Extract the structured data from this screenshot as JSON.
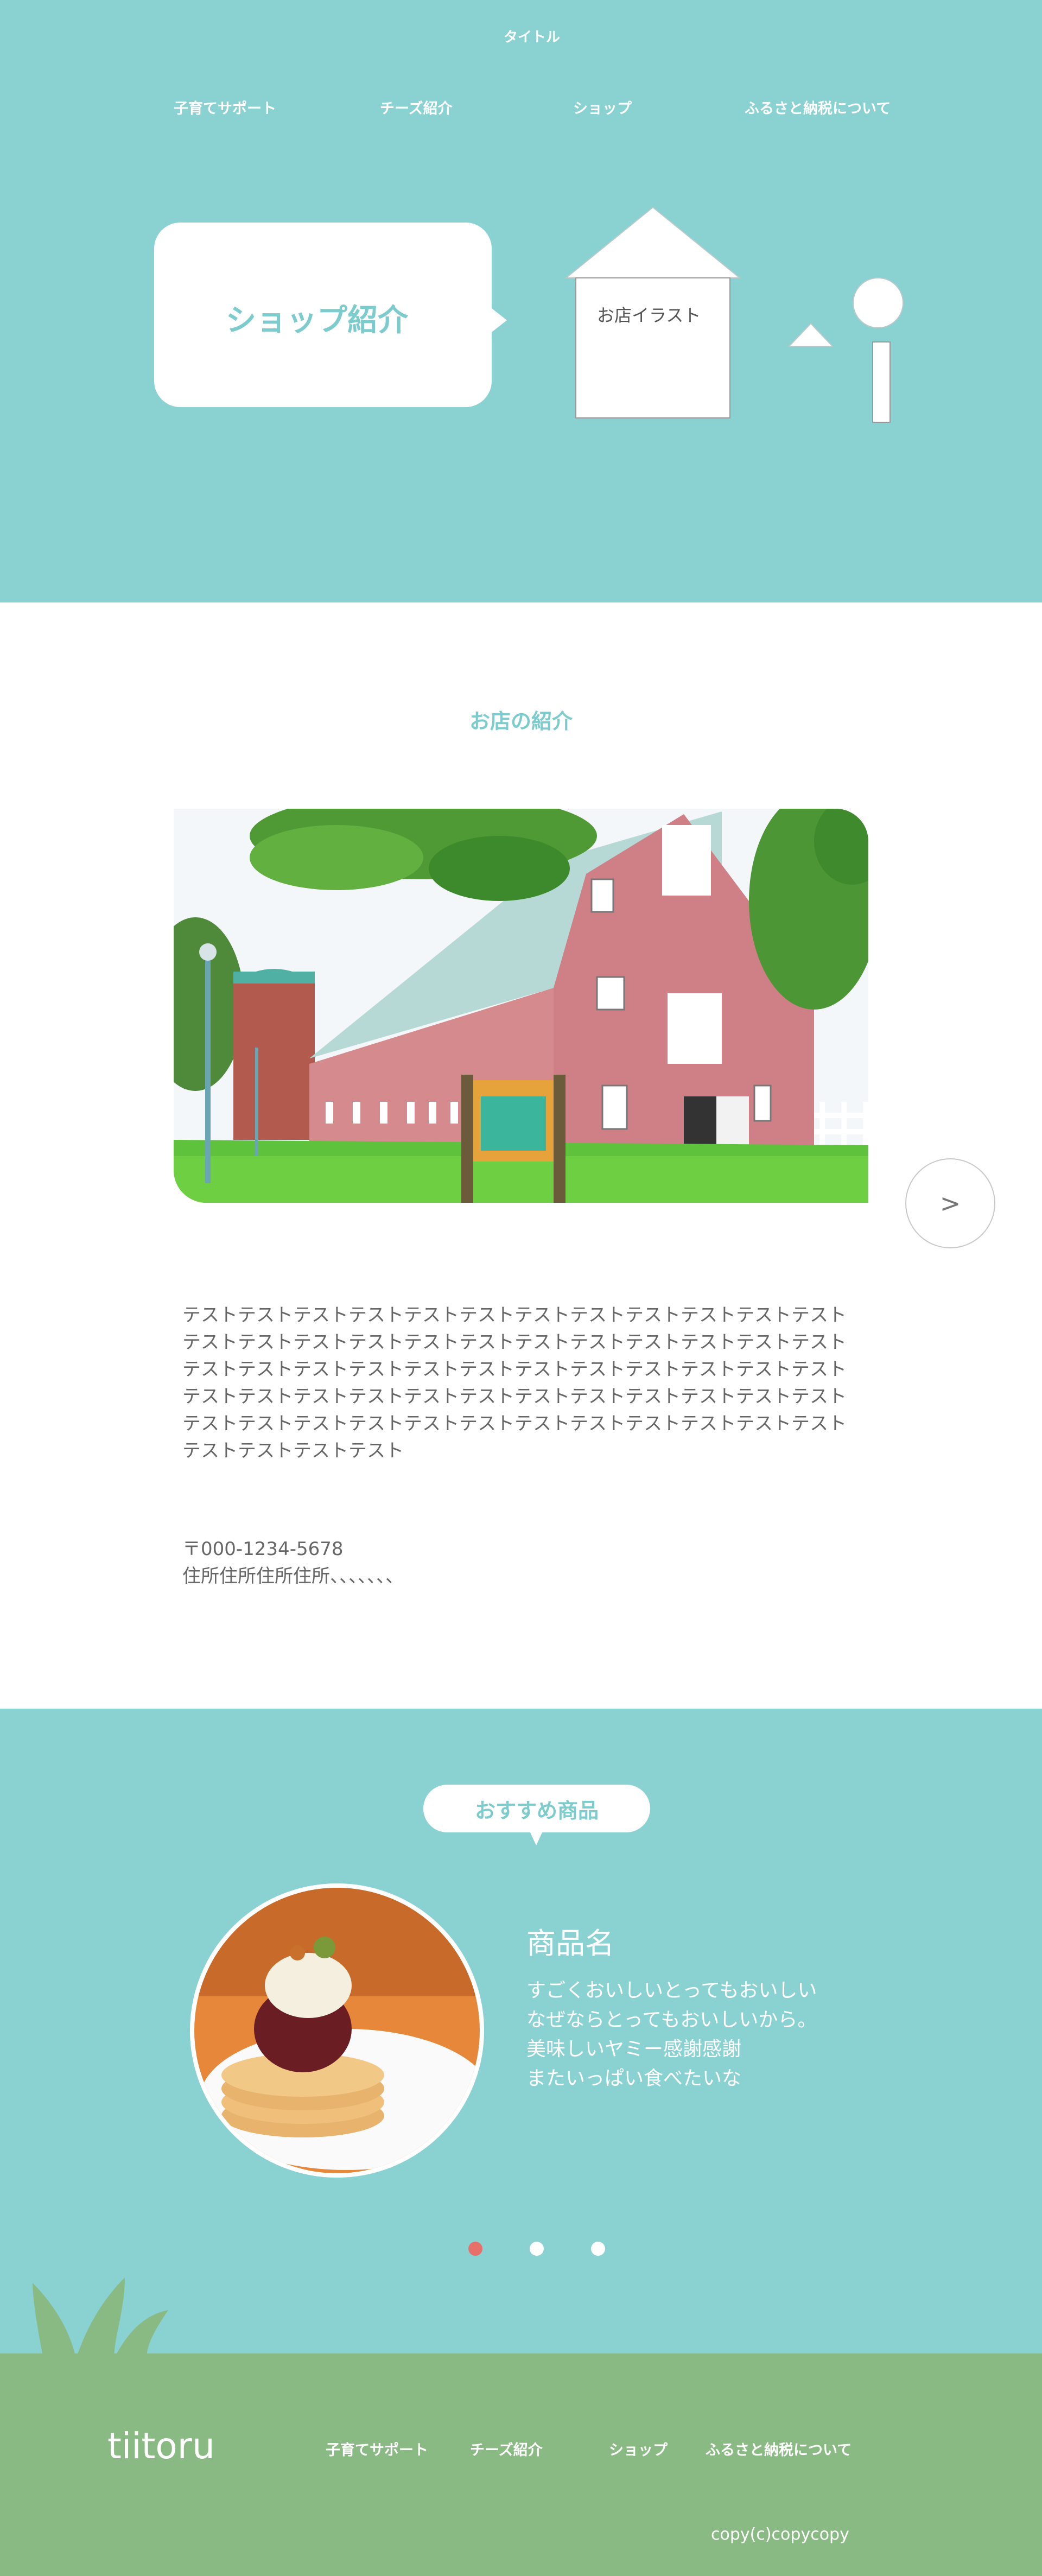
{
  "header": {
    "site_title": "タイトル",
    "nav": [
      "子育てサポート",
      "チーズ紹介",
      "ショップ",
      "ふるさと納税について"
    ]
  },
  "hero": {
    "title": "ショップ紹介",
    "shop_illustration_label": "お店イラスト"
  },
  "shop": {
    "heading": "お店の紹介",
    "next_button_label": ">",
    "text": "テストテストテストテストテストテストテストテストテストテストテストテストテストテストテストテストテストテストテストテストテストテストテストテストテストテストテストテストテストテストテストテストテストテストテストテストテストテストテストテストテストテストテストテストテストテストテストテストテストテストテストテストテストテストテストテストテストテストテストテストテストテストテストテスト",
    "postal": "〒000-1234-5678",
    "address": "住所住所住所住所、、、、、、、"
  },
  "recommended": {
    "badge": "おすすめ商品",
    "product_name": "商品名",
    "description": [
      "すごくおいしいとってもおいしい",
      "なぜならとってもおいしいから。",
      "美味しいヤミー感謝感謝",
      "またいっぱい食べたいな"
    ],
    "active_slide": 1,
    "slide_count": 3
  },
  "footer": {
    "logo": "tiitoru",
    "nav": [
      "子育てサポート",
      "チーズ紹介",
      "ショップ",
      "ふるさと納税について"
    ],
    "copyright": "copy(c)copycopy"
  },
  "colors": {
    "teal": "#8ad1d2",
    "teal_text": "#7ccbcd",
    "footer_green": "#8aba83",
    "dot_active": "#e8706a",
    "dot_inactive": "#ffffff"
  }
}
